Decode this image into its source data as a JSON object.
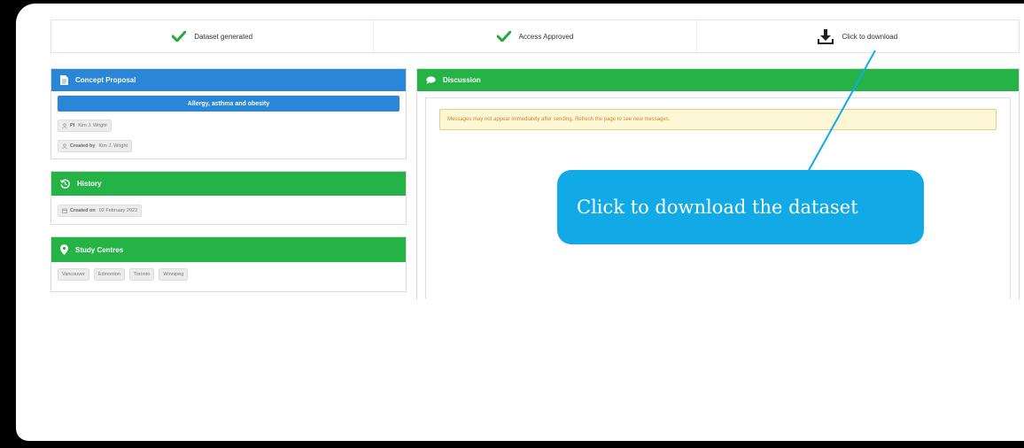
{
  "steps": [
    {
      "label": "Dataset generated",
      "icon": "check-icon"
    },
    {
      "label": "Access Approved",
      "icon": "check-icon"
    },
    {
      "label": "Click to download",
      "icon": "download-icon"
    }
  ],
  "concept": {
    "title": "Concept Proposal",
    "proposal_title": "Allergy, asthma and obesity",
    "pi_label": "PI",
    "pi_value": "Kim J. Wright",
    "created_by_label": "Created by",
    "created_by_value": "Kim J. Wright"
  },
  "history": {
    "title": "History",
    "created_on_label": "Created on",
    "created_on_value": "02 February 2022"
  },
  "centres": {
    "title": "Study Centres",
    "items": [
      "Vancouver",
      "Edmonton",
      "Toronto",
      "Winnipeg"
    ]
  },
  "discussion": {
    "title": "Discussion",
    "notice": "Messages may not appear immediately after sending. Refresh the page to see new messages."
  },
  "callout": {
    "text": "Click to download the dataset"
  },
  "colors": {
    "blue": "#2a86d6",
    "green": "#25b347",
    "callout": "#11aae6",
    "check": "#22aa3c"
  }
}
